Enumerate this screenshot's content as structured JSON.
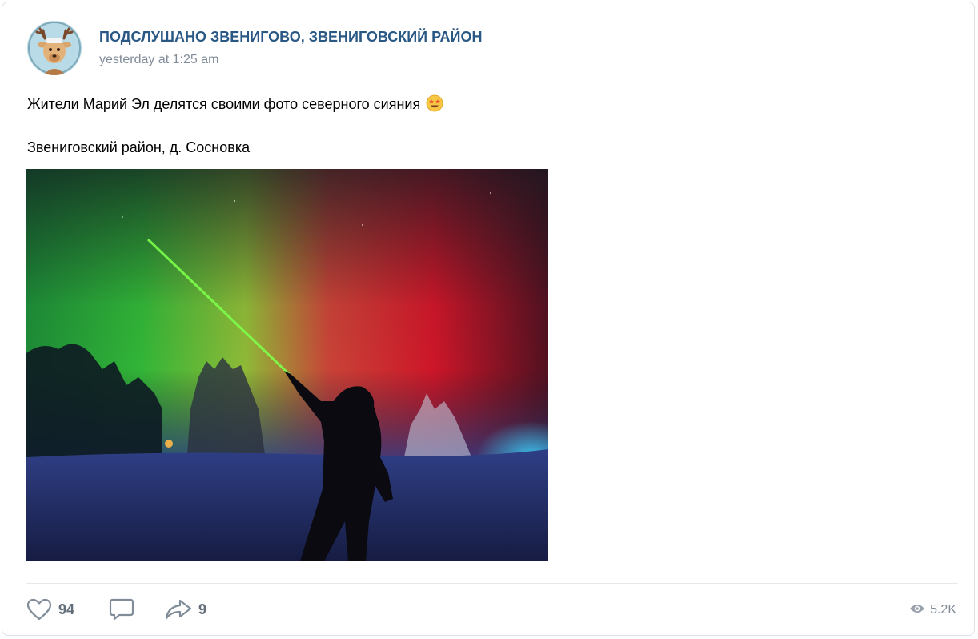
{
  "post": {
    "author": "ПОДСЛУШАНО ЗВЕНИГОВО, ЗВЕНИГОВСКИЙ РАЙОН",
    "date": "yesterday at 1:25 am",
    "text_line1": "Жители Марий Эл делятся своими фото северного сияния",
    "text_line2": "Звениговский район, д. Сосновка"
  },
  "actions": {
    "likes": "94",
    "shares": "9",
    "views": "5.2K"
  },
  "colors": {
    "link": "#2a5885",
    "muted": "#818c99",
    "icon": "#818c99"
  },
  "icons": {
    "like": "heart-icon",
    "comment": "comment-icon",
    "share": "share-arrow-icon",
    "views": "eye-icon",
    "emoji": "star-struck-emoji"
  }
}
